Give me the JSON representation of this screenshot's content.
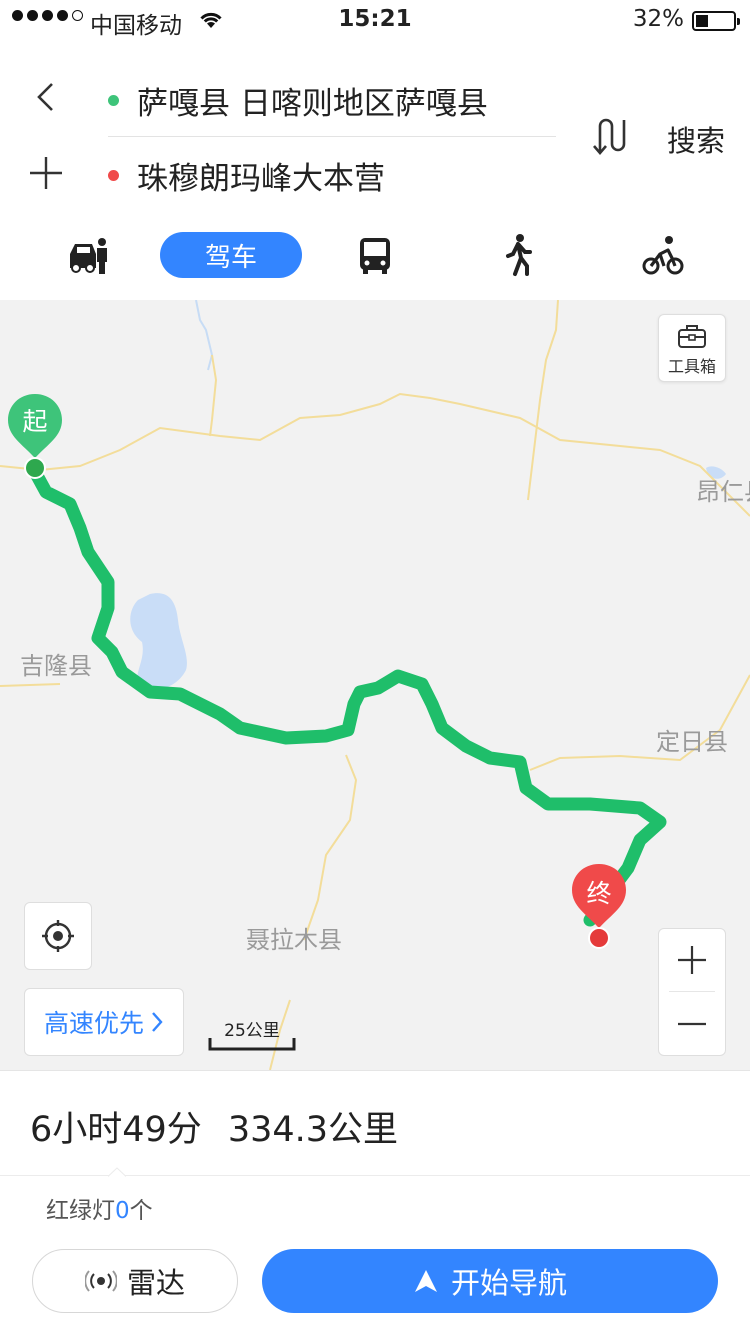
{
  "status_bar": {
    "carrier": "中国移动",
    "time": "15:21",
    "battery": "32%",
    "battery_level": 0.32
  },
  "route": {
    "origin": "萨嘎县 日喀则地区萨嘎县",
    "destination": "珠穆朗玛峰大本营",
    "search_label": "搜索",
    "origin_color": "#3ec47a",
    "destination_color": "#f04a4a"
  },
  "modes": {
    "taxi_icon": "taxi-icon",
    "drive_label": "驾车",
    "bus_icon": "bus-icon",
    "walk_icon": "walk-icon",
    "bike_icon": "bike-icon",
    "active": "驾车"
  },
  "map": {
    "start_marker": "起",
    "end_marker": "终",
    "toolbox_label": "工具箱",
    "highway_label": "高速优先",
    "scale_label": "25公里",
    "places": [
      "吉隆县",
      "定日县",
      "聂拉木县",
      "昂仁县"
    ],
    "route_color": "#1fbe6a",
    "accent": "#3385ff"
  },
  "summary": {
    "duration": "6小时49分",
    "distance": "334.3公里",
    "lights_label": "红绿灯",
    "lights_count": "0",
    "lights_unit": "个"
  },
  "actions": {
    "radar_label": "雷达",
    "navigate_label": "开始导航"
  }
}
